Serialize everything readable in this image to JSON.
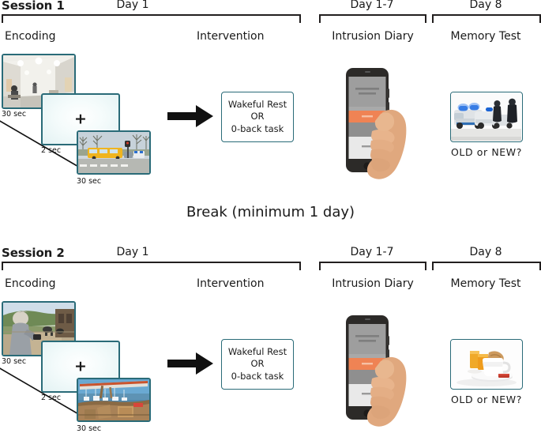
{
  "figure": {
    "break_label": "Break (minimum 1 day)",
    "accent_color": "#2a6b78",
    "phone_accent_color": "#ef8354"
  },
  "sessions": [
    {
      "label": "Session 1",
      "day_encoding": "Day 1",
      "day_diary": "Day 1-7",
      "day_memory": "Day 8",
      "phase_encoding": "Encoding",
      "phase_intervention": "Intervention",
      "phase_diary": "Intrusion Diary",
      "phase_memory": "Memory Test",
      "stim_1_duration": "30 sec",
      "fixation_duration": "2 sec",
      "fixation_symbol": "+",
      "stim_2_duration": "30 sec",
      "stim_1_name": "hospital-corridor-image",
      "stim_2_name": "bus-accident-image",
      "memory_probe": "OLD  or  NEW?",
      "memory_image_name": "police-cars-image",
      "intervention": {
        "line1": "Wakeful Rest",
        "line2": "OR",
        "line3": "0-back task"
      }
    },
    {
      "label": "Session 2",
      "day_encoding": "Day 1",
      "day_diary": "Day 1-7",
      "day_memory": "Day 8",
      "phase_encoding": "Encoding",
      "phase_intervention": "Intervention",
      "phase_diary": "Intrusion Diary",
      "phase_memory": "Memory Test",
      "stim_1_duration": "30 sec",
      "fixation_duration": "2 sec",
      "fixation_symbol": "+",
      "stim_2_duration": "30 sec",
      "stim_1_name": "man-outdoors-image",
      "stim_2_name": "harbour-boat-image",
      "memory_probe": "OLD  or  NEW?",
      "memory_image_name": "breakfast-juice-image",
      "intervention": {
        "line1": "Wakeful Rest",
        "line2": "OR",
        "line3": "0-back task"
      }
    }
  ]
}
